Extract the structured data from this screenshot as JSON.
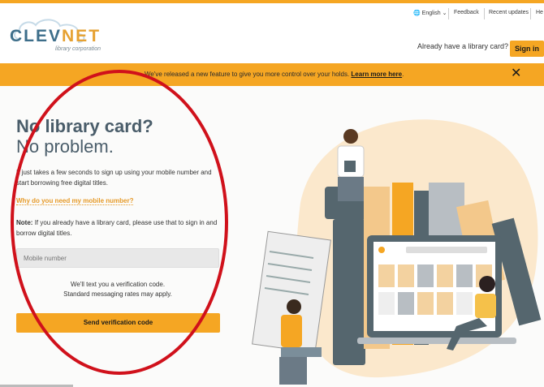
{
  "logo": {
    "brand": "CLEVNET",
    "brand_main": "CLEV",
    "brand_accent": "NET",
    "subtitle": "library corporation"
  },
  "utility_nav": {
    "language": "English",
    "feedback": "Feedback",
    "recent_updates": "Recent updates",
    "help_truncated": "He"
  },
  "header": {
    "already_text": "Already have a library card?",
    "signin_label": "Sign in"
  },
  "banner": {
    "text": "We've released a new feature to give you more control over your holds.",
    "link": "Learn more here",
    "link_suffix": "."
  },
  "main": {
    "headline_1": "No library card?",
    "headline_2": "No problem.",
    "description": "It just takes a few seconds to sign up using your mobile number and start borrowing free digital titles.",
    "why_link": "Why do you need my mobile number?",
    "note_label": "Note:",
    "note_text": "If you already have a library card, please use that to sign in and borrow digital titles.",
    "mobile_placeholder": "Mobile number",
    "text_code_line1": "We'll text you a verification code.",
    "text_code_line2": "Standard messaging rates may apply.",
    "send_label": "Send verification code"
  },
  "colors": {
    "accent": "#f5a623",
    "brand_blue": "#3d6e8a",
    "annotation_red": "#d0111b",
    "headline": "#4a5d6a"
  },
  "icons": {
    "globe": "globe-icon",
    "chevron": "chevron-down-icon",
    "close": "close-icon"
  }
}
